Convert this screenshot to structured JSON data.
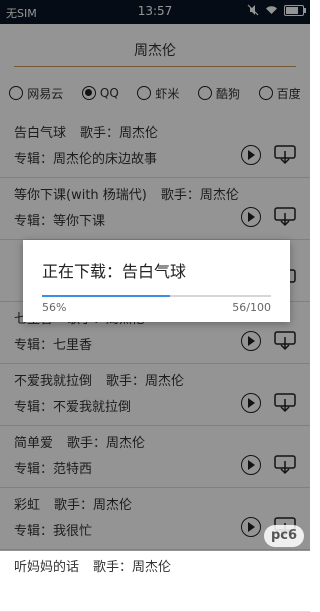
{
  "status": {
    "carrier": "无SIM",
    "time": "13:57"
  },
  "search": {
    "query": "周杰伦"
  },
  "sources": [
    {
      "label": "网易云",
      "selected": false
    },
    {
      "label": "QQ",
      "selected": true
    },
    {
      "label": "虾米",
      "selected": false
    },
    {
      "label": "酷狗",
      "selected": false
    },
    {
      "label": "百度",
      "selected": false
    }
  ],
  "songs": [
    {
      "title": "告白气球",
      "singer": "歌手：周杰伦",
      "album": "专辑：周杰伦的床边故事"
    },
    {
      "title": "等你下课(with 杨瑞代)",
      "singer": "歌手：周杰伦",
      "album": "专辑：等你下课"
    },
    {
      "title": "",
      "singer": "",
      "album": ""
    },
    {
      "title": "七里香",
      "singer": "歌手：周杰伦",
      "album": "专辑：七里香"
    },
    {
      "title": "不爱我就拉倒",
      "singer": "歌手：周杰伦",
      "album": "专辑：不爱我就拉倒"
    },
    {
      "title": "简单爱",
      "singer": "歌手：周杰伦",
      "album": "专辑：范特西"
    },
    {
      "title": "彩虹",
      "singer": "歌手：周杰伦",
      "album": "专辑：我很忙"
    },
    {
      "title": "听妈妈的话",
      "singer": "歌手：周杰伦",
      "album": ""
    }
  ],
  "dialog": {
    "title": "正在下载：告白气球",
    "percent_label": "56%",
    "count_label": "56/100",
    "progress": 0.56
  },
  "watermark": "pc6"
}
